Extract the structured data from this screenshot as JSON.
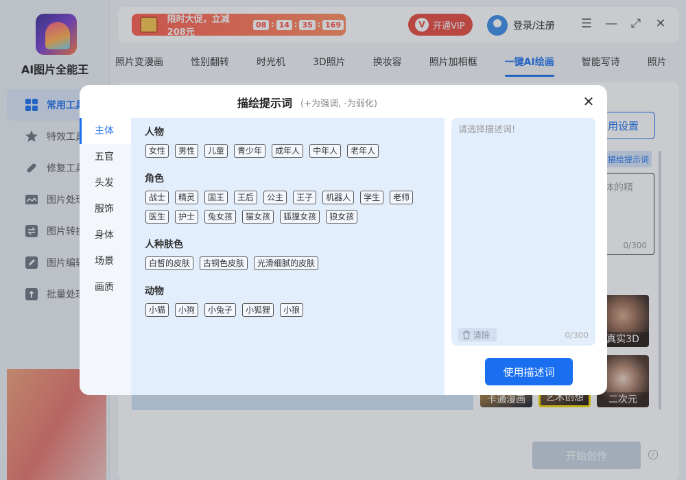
{
  "app": {
    "name": "AI图片全能王"
  },
  "sidebar": {
    "items": [
      {
        "label": "常用工具",
        "icon": "grid-icon"
      },
      {
        "label": "特效工具",
        "icon": "star-icon"
      },
      {
        "label": "修复工具",
        "icon": "bandage-icon"
      },
      {
        "label": "图片处理",
        "icon": "image-icon"
      },
      {
        "label": "图片转换",
        "icon": "convert-icon"
      },
      {
        "label": "图片编辑",
        "icon": "edit-icon"
      },
      {
        "label": "批量处理",
        "icon": "upload-icon"
      }
    ]
  },
  "topbar": {
    "promo_text": "限时大促，立减208元",
    "timer": [
      "08",
      "14",
      "35",
      "169"
    ],
    "vip_label": "开通VIP",
    "login_label": "登录/注册"
  },
  "tabs": [
    "照片变漫画",
    "性别翻转",
    "时光机",
    "3D照片",
    "换妆容",
    "照片加相框",
    "一键AI绘画",
    "智能写诗",
    "照片"
  ],
  "background": {
    "settings_label": "用设置",
    "prompt_tag": "描绘提示词",
    "textarea_text": "体的精",
    "textarea_count": "0/300",
    "styles": [
      {
        "label": "真实3D"
      },
      {
        "label": "卡通漫画"
      },
      {
        "label": "艺术创想"
      },
      {
        "label": "二次元"
      }
    ],
    "start_label": "开始创作"
  },
  "modal": {
    "title": "描绘提示词",
    "subtitle": "(+为强调, -为弱化)",
    "categories": [
      "主体",
      "五官",
      "头发",
      "服饰",
      "身体",
      "场景",
      "画质"
    ],
    "groups": [
      {
        "title": "人物",
        "words": [
          "女性",
          "男性",
          "儿童",
          "青少年",
          "成年人",
          "中年人",
          "老年人"
        ]
      },
      {
        "title": "角色",
        "words": [
          "战士",
          "精灵",
          "国王",
          "王后",
          "公主",
          "王子",
          "机器人",
          "学生",
          "老师",
          "医生",
          "护士",
          "兔女孩",
          "猫女孩",
          "狐狸女孩",
          "狼女孩"
        ]
      },
      {
        "title": "人种肤色",
        "words": [
          "白皙的皮肤",
          "古铜色皮肤",
          "光滑细腻的皮肤"
        ]
      },
      {
        "title": "动物",
        "words": [
          "小猫",
          "小狗",
          "小兔子",
          "小狐狸",
          "小狼"
        ]
      }
    ],
    "prompt_placeholder": "请选择描述词!",
    "clear_label": "清除",
    "count": "0/300",
    "use_label": "使用描述词"
  }
}
